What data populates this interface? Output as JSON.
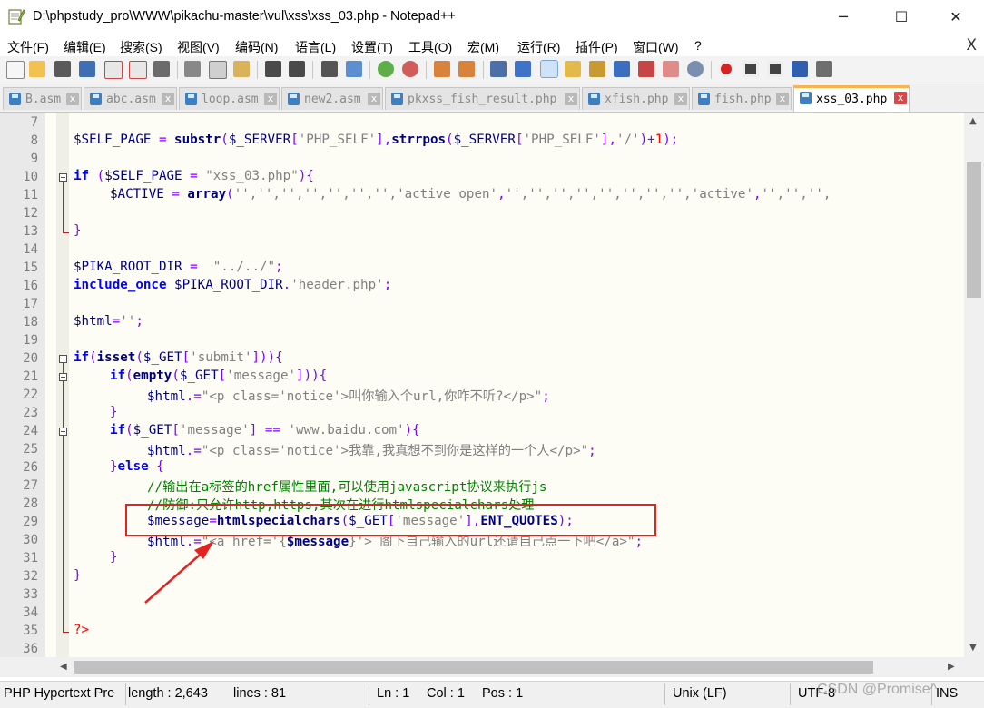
{
  "window": {
    "title": "D:\\phpstudy_pro\\WWW\\pikachu-master\\vul\\xss\\xss_03.php - Notepad++",
    "minimize": "─",
    "maximize": "☐",
    "close": "✕"
  },
  "menu": {
    "items": [
      "文件(F)",
      "编辑(E)",
      "搜索(S)",
      "视图(V)",
      "编码(N)",
      "语言(L)",
      "设置(T)",
      "工具(O)",
      "宏(M)",
      "运行(R)",
      "插件(P)",
      "窗口(W)",
      "?"
    ],
    "close": "X"
  },
  "tabs": [
    {
      "label": "B.asm",
      "close": "x"
    },
    {
      "label": "abc.asm",
      "close": "x"
    },
    {
      "label": "loop.asm",
      "close": "x"
    },
    {
      "label": "new2.asm",
      "close": "x"
    },
    {
      "label": "pkxss_fish_result.php",
      "close": "x"
    },
    {
      "label": "xfish.php",
      "close": "x"
    },
    {
      "label": "fish.php",
      "close": "x"
    },
    {
      "label": "xss_03.php",
      "close": "x",
      "active": true
    }
  ],
  "editor": {
    "line_numbers": [
      "7",
      "8",
      "9",
      "10",
      "11",
      "12",
      "13",
      "14",
      "15",
      "16",
      "17",
      "18",
      "19",
      "20",
      "21",
      "22",
      "23",
      "24",
      "25",
      "26",
      "27",
      "28",
      "29",
      "30",
      "31",
      "32",
      "33",
      "34",
      "35",
      "36"
    ],
    "lines": {
      "l8": {
        "a": "$SELF_PAGE",
        "b": " = ",
        "c": "substr",
        "d": "(",
        "e": "$_SERVER",
        "f": "[",
        "g": "'PHP_SELF'",
        "h": "],",
        "i": "strrpos",
        "j": "(",
        "k": "$_SERVER",
        "l": "[",
        "m": "'PHP_SELF'",
        "n": "],",
        "o": "'/'",
        "p": ")+",
        "q": "1",
        "r": ");"
      },
      "l10": {
        "a": "if",
        "b": " (",
        "c": "$SELF_PAGE",
        "d": " = ",
        "e": "\"xss_03.php\"",
        "f": "){"
      },
      "l11": {
        "a": "$ACTIVE",
        "b": " = ",
        "c": "array",
        "d": "(",
        "e": "'',",
        "f": "'',",
        "g": "'',",
        "h": "'',",
        "i": "'',",
        "j": "'',",
        "k": "'',",
        "l": "'active open'",
        "m": ",",
        "n": "'',",
        "o": "'',",
        "p": "'',",
        "q": "'',",
        "r": "'',",
        "s": "'',",
        "t": "'',",
        "u": "'',",
        "v": "'active'",
        "w": ",",
        "x": "'',",
        "y": "'',",
        "z": "'',"
      },
      "l13": {
        "a": "}"
      },
      "l15": {
        "a": "$PIKA_ROOT_DIR",
        "b": " =  ",
        "c": "\"../../\"",
        "d": ";"
      },
      "l16": {
        "a": "include_once",
        "b": " ",
        "c": "$PIKA_ROOT_DIR",
        "d": ".",
        "e": "'header.php'",
        "f": ";"
      },
      "l18": {
        "a": "$html",
        "b": "=",
        "c": "''",
        "d": ";"
      },
      "l20": {
        "a": "if",
        "b": "(",
        "c": "isset",
        "d": "(",
        "e": "$_GET",
        "f": "[",
        "g": "'submit'",
        "h": "])){"
      },
      "l21": {
        "a": "if",
        "b": "(",
        "c": "empty",
        "d": "(",
        "e": "$_GET",
        "f": "[",
        "g": "'message'",
        "h": "])){"
      },
      "l22": {
        "a": "$html",
        "b": ".=",
        "c": "\"<p class='notice'>叫你输入个url,你咋不听?</p>\"",
        "d": ";"
      },
      "l23": {
        "a": "}"
      },
      "l24": {
        "a": "if",
        "b": "(",
        "c": "$_GET",
        "d": "[",
        "e": "'message'",
        "f": "] == ",
        "g": "'www.baidu.com'",
        "h": "){"
      },
      "l25": {
        "a": "$html",
        "b": ".=",
        "c": "\"<p class='notice'>我靠,我真想不到你是这样的一个人</p>\"",
        "d": ";"
      },
      "l26": {
        "a": "}",
        "b": "else",
        "c": " {"
      },
      "l27": {
        "a": "//输出在a标签的href属性里面,可以使用javascript协议来执行js"
      },
      "l28": {
        "a": "//防御:只允许http,https,其次在进行htmlspecialchars处理"
      },
      "l29": {
        "a": "$message",
        "b": "=",
        "c": "htmlspecialchars",
        "d": "(",
        "e": "$_GET",
        "f": "[",
        "g": "'message'",
        "h": "],",
        "i": "ENT_QUOTES",
        "j": ");"
      },
      "l30": {
        "a": "$html",
        "b": ".=",
        "c": "\"<a href='{",
        "d": "$message",
        "e": "}'> 阁下自己输入的url还请自己点一下吧</a>\"",
        "f": ";"
      },
      "l31": {
        "a": "}"
      },
      "l32": {
        "a": "}"
      },
      "l35": {
        "a": "?>"
      }
    }
  },
  "scrollbars": {
    "up": "▲",
    "down": "▼",
    "left": "◀",
    "right": "▶"
  },
  "status": {
    "language": "PHP Hypertext Pre",
    "length": "length : 2,643",
    "lines": "lines : 81",
    "ln": "Ln : 1",
    "col": "Col : 1",
    "pos": "Pos : 1",
    "eol": "Unix (LF)",
    "encoding": "UTF-8",
    "mode": "INS",
    "watermark": "CSDN @Promise^"
  },
  "colors": {
    "keyword": "#0000ff",
    "variable": "#000080",
    "string": "#808080",
    "operator": "#8000ff",
    "number": "#ff0000",
    "comment": "#008000",
    "annotation": "#e52222",
    "active_tab": "#fab24c"
  }
}
